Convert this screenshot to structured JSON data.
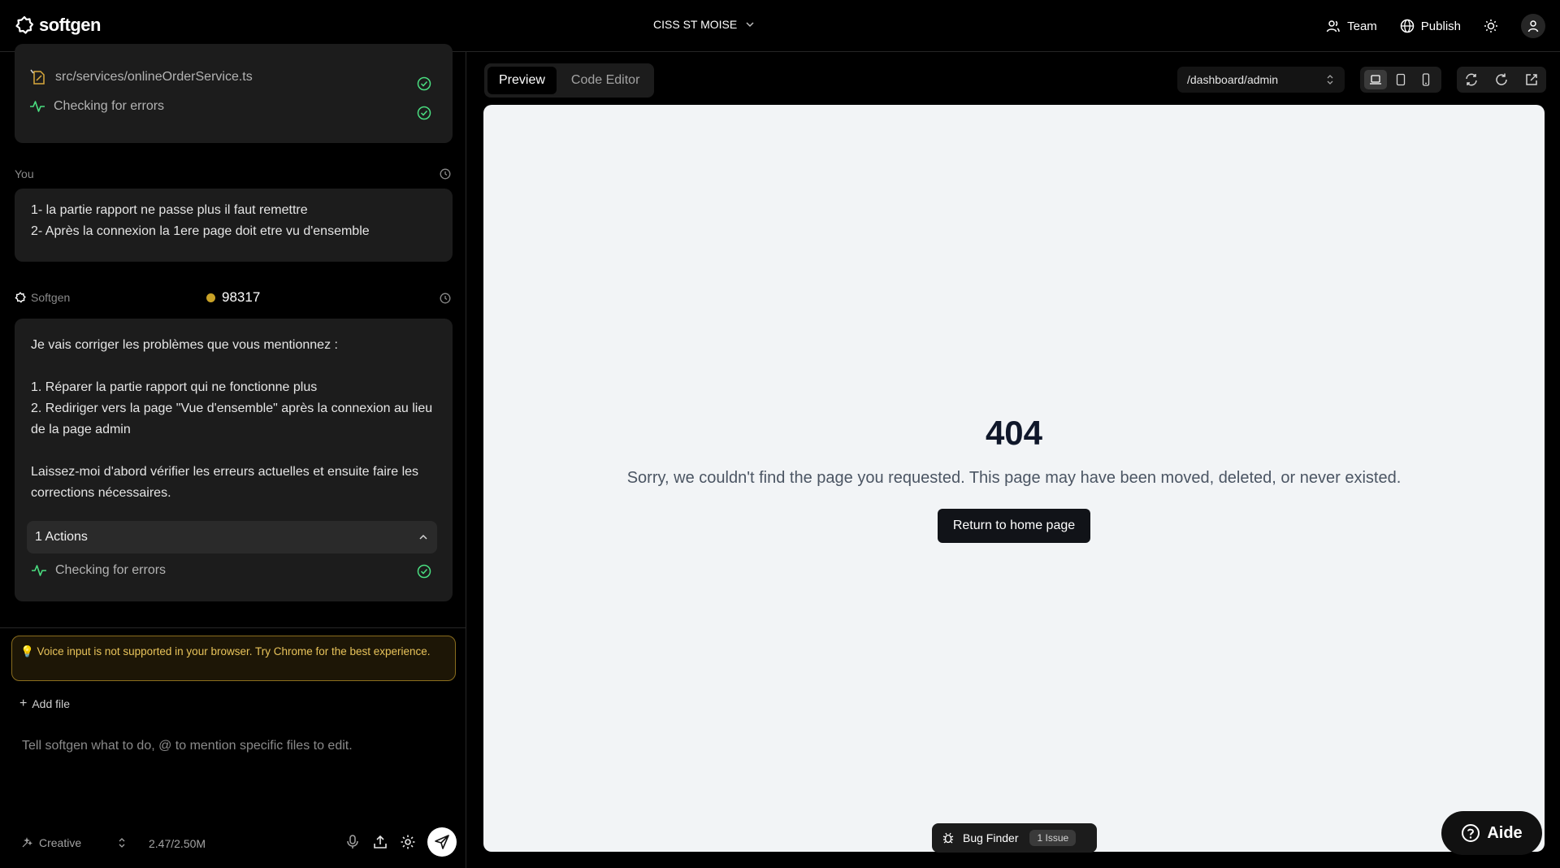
{
  "header": {
    "logo_text": "softgen",
    "project_name": "CISS ST MOISE",
    "team_label": "Team",
    "publish_label": "Publish"
  },
  "chat": {
    "file_path": "src/services/onlineOrderService.ts",
    "checking_label_1": "Checking for errors",
    "user_label": "You",
    "user_message_line1": "1- la partie rapport ne passe plus il faut remettre",
    "user_message_line2": "2- Après la connexion la 1ere page doit etre vu d'ensemble",
    "assistant_label": "Softgen",
    "credits": "98317",
    "assistant_intro": "Je vais corriger les problèmes que vous mentionnez :",
    "assistant_item1": "1. Réparer la partie rapport qui ne fonctionne plus",
    "assistant_item2": "2. Rediriger vers la page \"Vue d'ensemble\" après la connexion au lieu de la page admin",
    "assistant_outro": "Laissez-moi d'abord vérifier les erreurs actuelles et ensuite faire les corrections nécessaires.",
    "actions_label": "1 Actions",
    "checking_label_2": "Checking for errors",
    "voice_warning": "💡 Voice input is not supported in your browser. Try Chrome for the best experience.",
    "add_file_label": "Add file",
    "prompt_placeholder": "Tell softgen what to do, @ to mention specific files to edit.",
    "mode_label": "Creative",
    "token_usage": "2.47/2.50M"
  },
  "preview": {
    "tab_preview": "Preview",
    "tab_code_editor": "Code Editor",
    "route": "/dashboard/admin",
    "error_code": "404",
    "error_message": "Sorry, we couldn't find the page you requested. This page may have been moved, deleted, or never existed.",
    "home_button": "Return to home page",
    "bug_finder_label": "Bug Finder",
    "issue_count": "1 Issue",
    "help_label": "Aide"
  },
  "colors": {
    "check_green": "#4ade80",
    "activity_green": "#4ade80",
    "coin_gold": "#c9a227",
    "warning_text": "#e8c35a"
  }
}
